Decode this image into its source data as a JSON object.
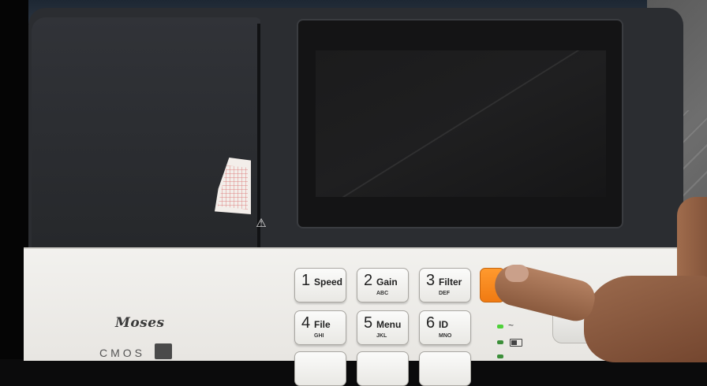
{
  "device": {
    "brand": "Moses",
    "model_text": "CMOS",
    "warning_symbol": "⚠"
  },
  "keypad": {
    "keys": [
      {
        "num": "1",
        "label": "Speed",
        "sub": ""
      },
      {
        "num": "2",
        "label": "Gain",
        "sub": "ABC"
      },
      {
        "num": "3",
        "label": "Filter",
        "sub": "DEF"
      },
      {
        "num": "4",
        "label": "File",
        "sub": "GHI"
      },
      {
        "num": "5",
        "label": "Menu",
        "sub": "JKL"
      },
      {
        "num": "6",
        "label": "ID",
        "sub": "MNO"
      }
    ]
  },
  "indicators": {
    "ac_symbol": "~",
    "nav_arrow": "⇧"
  },
  "colors": {
    "body": "#2b2d31",
    "panel": "#f2f1ee",
    "orange_key": "#f07a12",
    "led_green": "#4fd13a"
  }
}
